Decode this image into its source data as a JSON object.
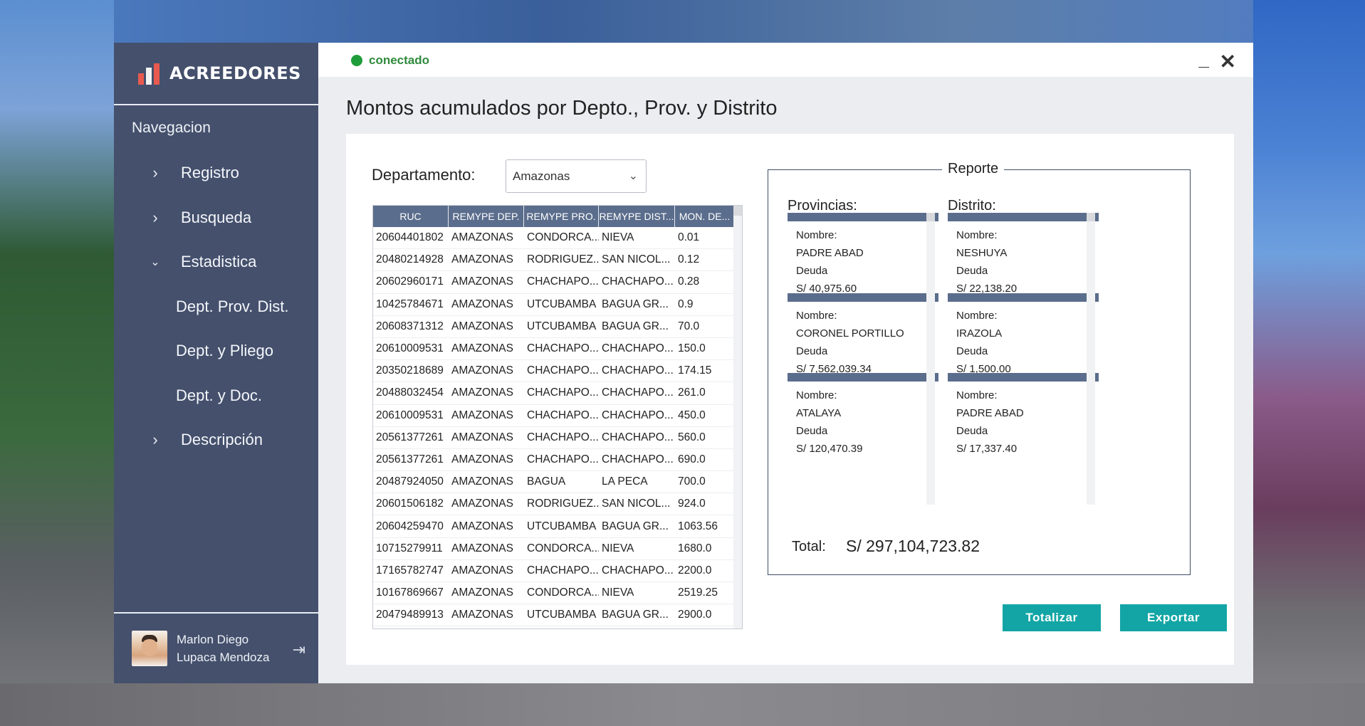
{
  "app": {
    "title": "ACREEDORES",
    "status": "conectado"
  },
  "sidebar": {
    "heading": "Navegacion",
    "items": [
      {
        "label": "Registro",
        "icon": "chevron-right-icon"
      },
      {
        "label": "Busqueda",
        "icon": "chevron-right-icon"
      },
      {
        "label": "Estadistica",
        "icon": "chevron-down-icon"
      },
      {
        "label": "Dept. Prov. Dist."
      },
      {
        "label": "Dept. y Pliego"
      },
      {
        "label": "Dept. y Doc."
      },
      {
        "label": "Descripción",
        "icon": "chevron-right-icon"
      }
    ],
    "user": {
      "first": "Marlon Diego",
      "last": "Lupaca Mendoza"
    }
  },
  "page": {
    "title": "Montos acumulados por Depto., Prov. y Distrito"
  },
  "filter": {
    "label": "Departamento:",
    "selected": "Amazonas"
  },
  "table": {
    "headers": [
      "RUC",
      "REMYPE DEP.",
      "REMYPE PRO.",
      "REMYPE DIST...",
      "MON. DE..."
    ],
    "rows": [
      [
        "20604401802",
        "AMAZONAS",
        "CONDORCA...",
        "NIEVA",
        "0.01"
      ],
      [
        "20480214928",
        "AMAZONAS",
        "RODRIGUEZ...",
        "SAN NICOL...",
        "0.12"
      ],
      [
        "20602960171",
        "AMAZONAS",
        "CHACHAPO...",
        "CHACHAPO...",
        "0.28"
      ],
      [
        "10425784671",
        "AMAZONAS",
        "UTCUBAMBA",
        "BAGUA GR...",
        "0.9"
      ],
      [
        "20608371312",
        "AMAZONAS",
        "UTCUBAMBA",
        "BAGUA GR...",
        "70.0"
      ],
      [
        "20610009531",
        "AMAZONAS",
        "CHACHAPO...",
        "CHACHAPO...",
        "150.0"
      ],
      [
        "20350218689",
        "AMAZONAS",
        "CHACHAPO...",
        "CHACHAPO...",
        "174.15"
      ],
      [
        "20488032454",
        "AMAZONAS",
        "CHACHAPO...",
        "CHACHAPO...",
        "261.0"
      ],
      [
        "20610009531",
        "AMAZONAS",
        "CHACHAPO...",
        "CHACHAPO...",
        "450.0"
      ],
      [
        "20561377261",
        "AMAZONAS",
        "CHACHAPO...",
        "CHACHAPO...",
        "560.0"
      ],
      [
        "20561377261",
        "AMAZONAS",
        "CHACHAPO...",
        "CHACHAPO...",
        "690.0"
      ],
      [
        "20487924050",
        "AMAZONAS",
        "BAGUA",
        "LA PECA",
        "700.0"
      ],
      [
        "20601506182",
        "AMAZONAS",
        "RODRIGUEZ...",
        "SAN NICOL...",
        "924.0"
      ],
      [
        "20604259470",
        "AMAZONAS",
        "UTCUBAMBA",
        "BAGUA GR...",
        "1063.56"
      ],
      [
        "10715279911",
        "AMAZONAS",
        "CONDORCA...",
        "NIEVA",
        "1680.0"
      ],
      [
        "17165782747",
        "AMAZONAS",
        "CHACHAPO...",
        "CHACHAPO...",
        "2200.0"
      ],
      [
        "10167869667",
        "AMAZONAS",
        "CONDORCA...",
        "NIEVA",
        "2519.25"
      ],
      [
        "20479489913",
        "AMAZONAS",
        "UTCUBAMBA",
        "BAGUA GR...",
        "2900.0"
      ]
    ]
  },
  "report": {
    "legend": "Reporte",
    "provincias_title": "Provincias:",
    "distrito_title": "Distrito:",
    "name_label": "Nombre:",
    "debt_label": "Deuda",
    "provincias": [
      {
        "name": "PADRE ABAD",
        "debt": "S/ 40,975.60"
      },
      {
        "name": "CORONEL PORTILLO",
        "debt": "S/ 7,562,039.34"
      },
      {
        "name": "ATALAYA",
        "debt": "S/ 120,470.39"
      }
    ],
    "distritos": [
      {
        "name": "NESHUYA",
        "debt": "S/ 22,138.20"
      },
      {
        "name": "IRAZOLA",
        "debt": "S/ 1,500.00"
      },
      {
        "name": "PADRE ABAD",
        "debt": "S/ 17,337.40"
      }
    ],
    "total_label": "Total:",
    "total_value": "S/ 297,104,723.82"
  },
  "buttons": {
    "totalizar": "Totalizar",
    "exportar": "Exportar"
  },
  "colors": {
    "sidebar": "#44506c",
    "header": "#5b6d8c",
    "accent": "#13a5a5",
    "status": "#1f9d3a"
  }
}
